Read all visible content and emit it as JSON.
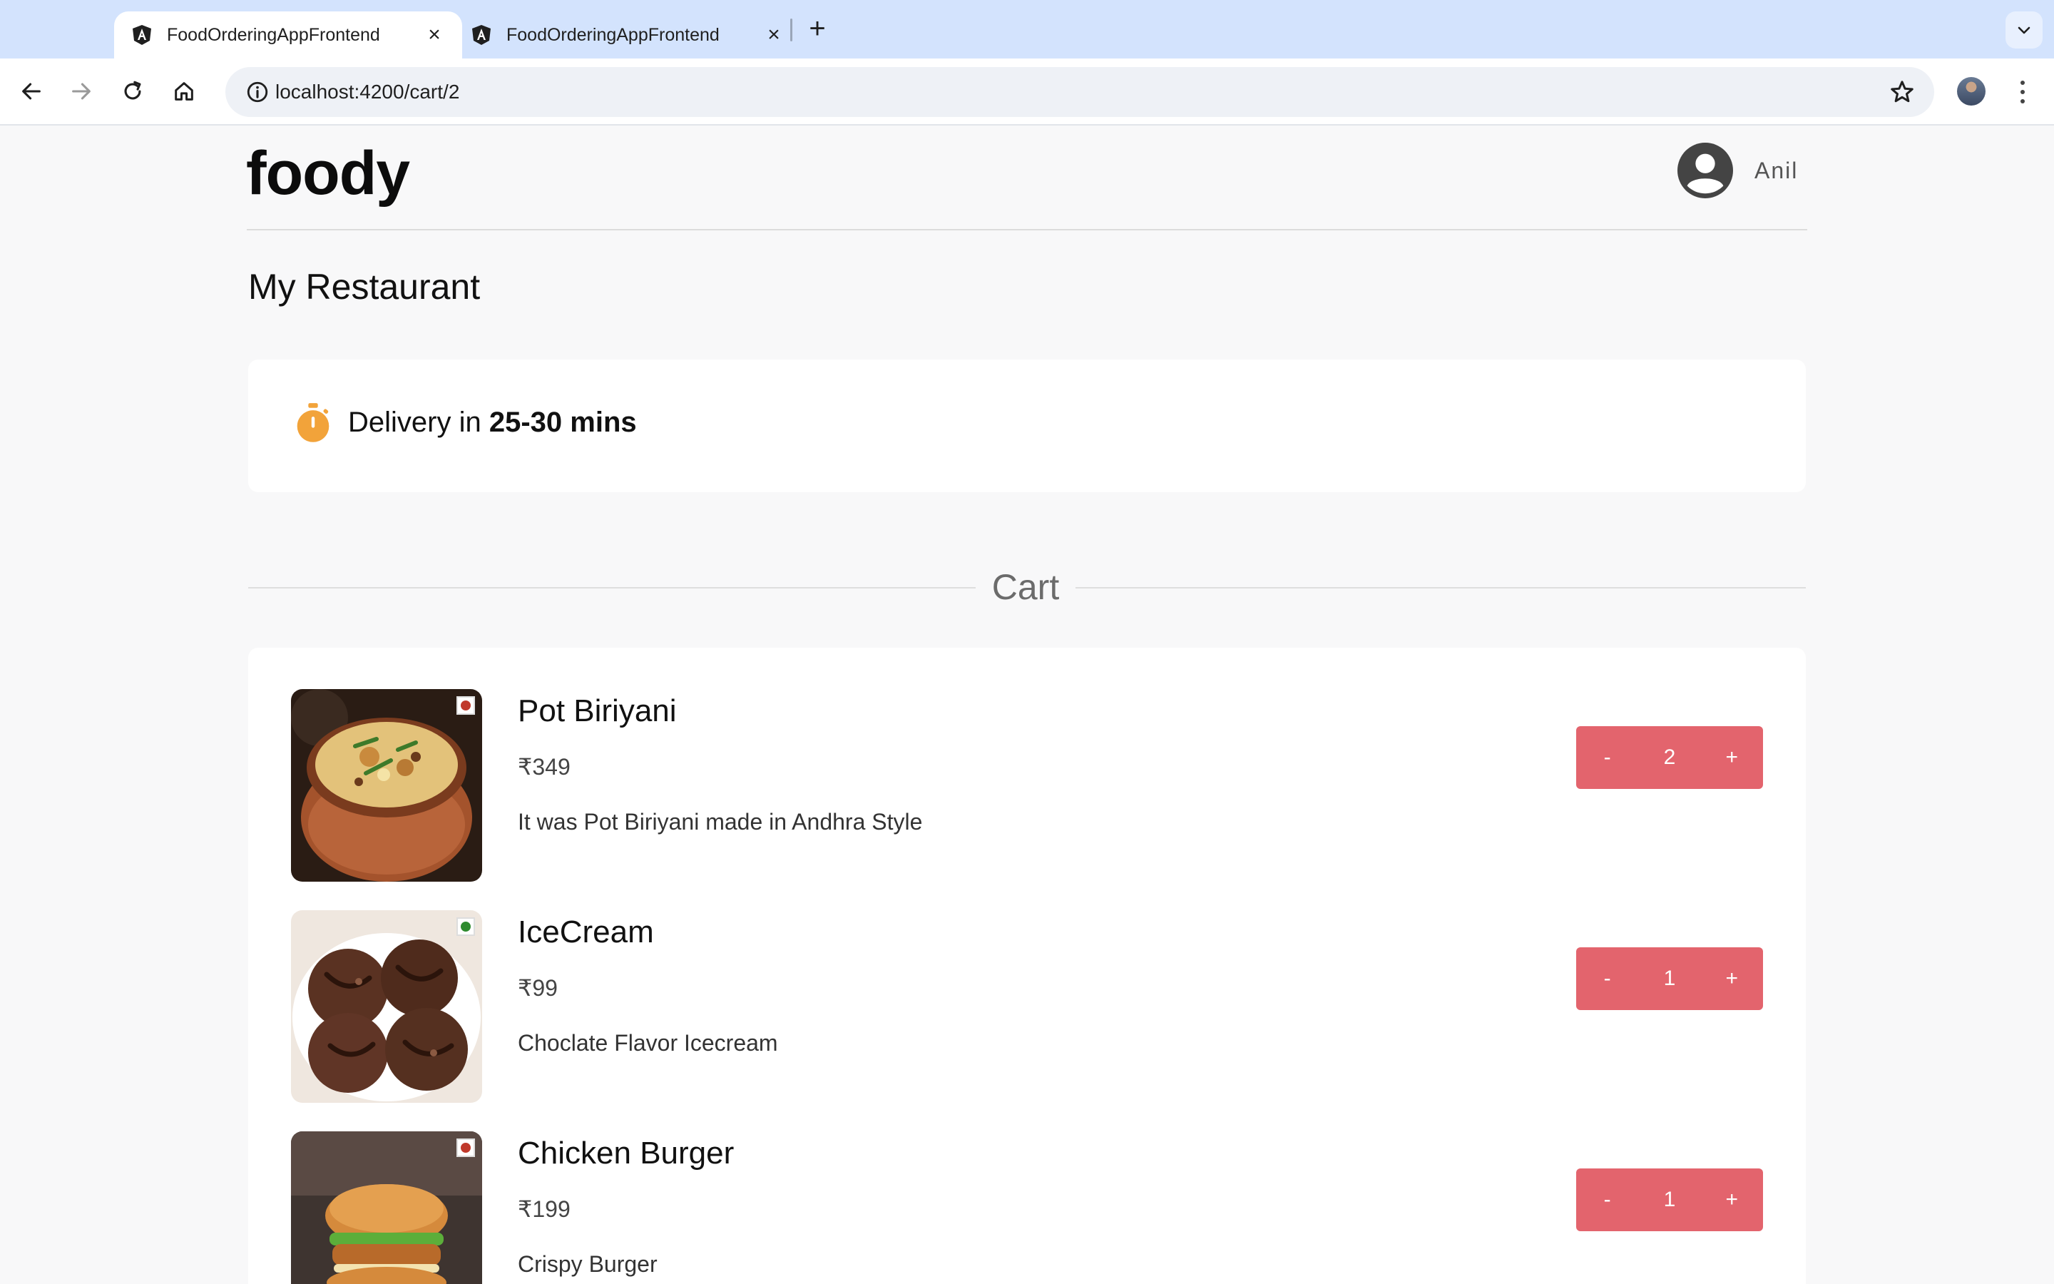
{
  "browser": {
    "tabs": [
      {
        "title": "FoodOrderingAppFrontend",
        "active": true
      },
      {
        "title": "FoodOrderingAppFrontend",
        "active": false
      }
    ],
    "new_tab_label": "+",
    "url": "localhost:4200/cart/2"
  },
  "header": {
    "logo": "foody",
    "user_name": "Anil"
  },
  "restaurant": {
    "name": "My Restaurant",
    "delivery_prefix": "Delivery in ",
    "delivery_time": "25-30 mins"
  },
  "cart": {
    "title": "Cart",
    "items": [
      {
        "name": "Pot Biriyani",
        "price": "₹349",
        "description": "It was Pot Biriyani made in Andhra Style",
        "quantity": "2",
        "minus": "-",
        "plus": "+",
        "diet": "non-veg"
      },
      {
        "name": "IceCream",
        "price": "₹99",
        "description": "Choclate Flavor Icecream",
        "quantity": "1",
        "minus": "-",
        "plus": "+",
        "diet": "veg"
      },
      {
        "name": "Chicken Burger",
        "price": "₹199",
        "description": "Crispy Burger",
        "quantity": "1",
        "minus": "-",
        "plus": "+",
        "diet": "non-veg"
      }
    ]
  },
  "colors": {
    "accent": "#e3646d",
    "tabstrip": "#d3e3fd",
    "veg": "#2e8b2e",
    "nonveg": "#c0392b",
    "timer": "#f2a33a"
  }
}
